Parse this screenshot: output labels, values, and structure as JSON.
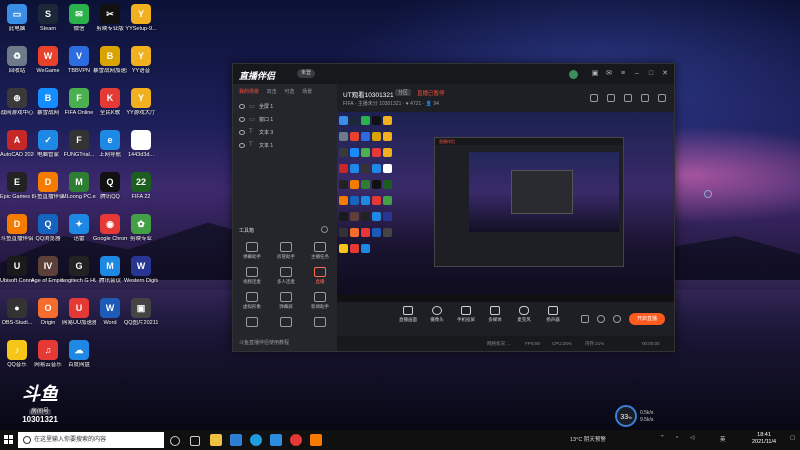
{
  "desktop": {
    "icons": [
      {
        "label": "此电脑",
        "color": "#3a8ee6",
        "glyph": "▭"
      },
      {
        "label": "Steam",
        "color": "#1b2838",
        "glyph": "S"
      },
      {
        "label": "微信",
        "color": "#2bb24c",
        "glyph": "✉"
      },
      {
        "label": "剪映专业版",
        "color": "#111111",
        "glyph": "✂"
      },
      {
        "label": "YYSetup-9...",
        "color": "#f0b020",
        "glyph": "Y"
      },
      {
        "label": "回收站",
        "color": "#6c7a89",
        "glyph": "♻"
      },
      {
        "label": "WeGame",
        "color": "#e8422c",
        "glyph": "W"
      },
      {
        "label": "TBBVPN",
        "color": "#2d6cdf",
        "glyph": "V"
      },
      {
        "label": "暴雪战网加速器",
        "color": "#d9a400",
        "glyph": "B"
      },
      {
        "label": "YY语音",
        "color": "#f0b020",
        "glyph": "Y"
      },
      {
        "label": "战网游戏中心",
        "color": "#3a3a3a",
        "glyph": "⊕"
      },
      {
        "label": "暴雪战网",
        "color": "#148eff",
        "glyph": "B"
      },
      {
        "label": "FIFA Online",
        "color": "#4caf50",
        "glyph": "F"
      },
      {
        "label": "全民K歌",
        "color": "#e53935",
        "glyph": "K"
      },
      {
        "label": "YY游戏大厅",
        "color": "#f0b020",
        "glyph": "Y"
      },
      {
        "label": "AutoCAD 2020 - 简...",
        "color": "#c62828",
        "glyph": "A"
      },
      {
        "label": "电脑管家",
        "color": "#1e88e5",
        "glyph": "✓"
      },
      {
        "label": "FUNGTrial...",
        "color": "#333333",
        "glyph": "F"
      },
      {
        "label": "上网导航",
        "color": "#1e88e5",
        "glyph": "e"
      },
      {
        "label": "1443d3d...",
        "color": "#ffffff",
        "glyph": ""
      },
      {
        "label": "Epic Games Launcher",
        "color": "#222222",
        "glyph": "E"
      },
      {
        "label": "斗鱼直播伴侣",
        "color": "#f57c00",
        "glyph": "D"
      },
      {
        "label": "MLoong PC.exe",
        "color": "#2e7d32",
        "glyph": "M"
      },
      {
        "label": "腾讯QQ",
        "color": "#111111",
        "glyph": "Q"
      },
      {
        "label": "FIFA 22",
        "color": "#1b5e20",
        "glyph": "22"
      },
      {
        "label": "斗鱼直播伴侣",
        "color": "#f57c00",
        "glyph": "D"
      },
      {
        "label": "QQ浏览器",
        "color": "#1565c0",
        "glyph": "Q"
      },
      {
        "label": "迅雷",
        "color": "#1e88e5",
        "glyph": "✦"
      },
      {
        "label": "Google Chrome",
        "color": "#e53935",
        "glyph": "◉"
      },
      {
        "label": "剪映专业",
        "color": "#43a047",
        "glyph": "✿"
      },
      {
        "label": "Ubisoft Connect",
        "color": "#1a1a1a",
        "glyph": "U"
      },
      {
        "label": "Age of Empires IV",
        "color": "#5d4037",
        "glyph": "IV"
      },
      {
        "label": "Logitech G HUB",
        "color": "#222222",
        "glyph": "G"
      },
      {
        "label": "腾讯会议",
        "color": "#1e88e5",
        "glyph": "M"
      },
      {
        "label": "Western Digital D...",
        "color": "#283593",
        "glyph": "W"
      },
      {
        "label": "OBS-Studi...",
        "color": "#333333",
        "glyph": "●"
      },
      {
        "label": "Origin",
        "color": "#f56c2d",
        "glyph": "O"
      },
      {
        "label": "网易UU加速器",
        "color": "#e53935",
        "glyph": "U"
      },
      {
        "label": "Word",
        "color": "#1e5bb8",
        "glyph": "W"
      },
      {
        "label": "QQ图片20211104...",
        "color": "#444444",
        "glyph": "▣"
      },
      {
        "label": "QQ音乐",
        "color": "#f5c518",
        "glyph": "♪"
      },
      {
        "label": "网易云音乐",
        "color": "#e53935",
        "glyph": "♫"
      },
      {
        "label": "百度网盘",
        "color": "#1e88e5",
        "glyph": "☁"
      }
    ]
  },
  "app": {
    "logo_text": "直播伴侣",
    "badge": "未登",
    "left": {
      "tabs": [
        "我的场景",
        "双击",
        "可选",
        "场景"
      ],
      "scenes": [
        "全屏 1",
        "窗口 1",
        "文本 3",
        "文本 1"
      ],
      "tool_header": "工具箱",
      "tools": [
        {
          "label": "弹幕助手",
          "red": false
        },
        {
          "label": "房管助手",
          "red": false
        },
        {
          "label": "主播任务",
          "red": false
        },
        {
          "label": "视频连麦",
          "red": false
        },
        {
          "label": "多人连麦",
          "red": false
        },
        {
          "label": "直播",
          "red": true
        },
        {
          "label": "虚拟形象",
          "red": false
        },
        {
          "label": "弹幕屏",
          "red": false
        },
        {
          "label": "新闻助手",
          "red": false
        },
        {
          "label": "",
          "red": false
        },
        {
          "label": "",
          "red": false
        },
        {
          "label": "",
          "red": false
        }
      ],
      "footer": "斗鱼直播伴侣使用教程"
    },
    "main": {
      "room_title": "UT观看10301321",
      "room_tag": "分区",
      "room_status": "直播已暂停",
      "room_sub": "FIFA · 主播未分 10301321 · ♥ 4721 · 👤 94",
      "tools": [
        "直播画面",
        "摄像头",
        "手机投屏",
        "多媒体",
        "麦克风",
        "扬声器"
      ],
      "live_button": "开启直播",
      "status_items": [
        "网络状况 ....",
        "FPS:60",
        "CPU:25%",
        "内存:21%",
        "00:00:00"
      ]
    }
  },
  "taskbar": {
    "search_placeholder": "在这里输入你要搜索的内容",
    "tray_weather": "13°C 阴天预警",
    "tray_lang": "英",
    "time": "18:41",
    "date": "2021/11/4"
  },
  "overlay": {
    "watermark_big": "斗鱼",
    "watermark_tag": "房间号",
    "watermark_num": "10301321",
    "gauge_value": "33",
    "gauge_unit": "%",
    "net_up": "0.5k/s",
    "net_down": "9.5k/s"
  }
}
